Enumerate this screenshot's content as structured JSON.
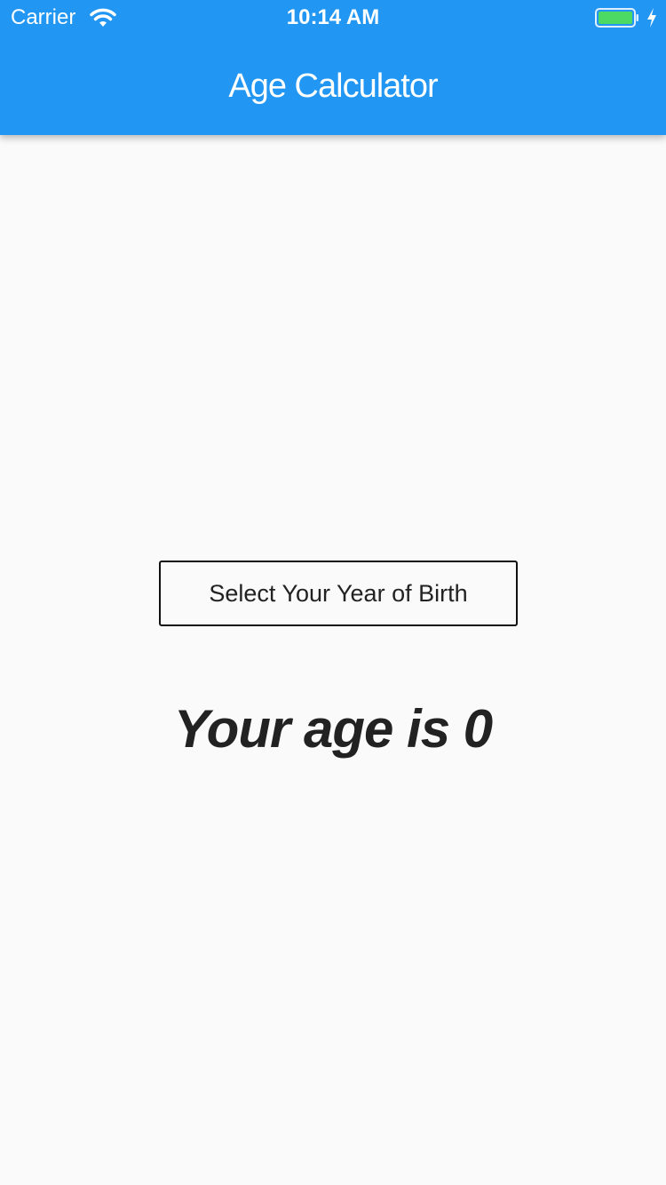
{
  "status_bar": {
    "carrier": "Carrier",
    "time": "10:14 AM",
    "wifi_icon": "wifi-icon",
    "battery_icon": "battery-icon",
    "charging_icon": "charging-bolt-icon",
    "battery_level": 1.0
  },
  "app_bar": {
    "title": "Age Calculator",
    "color": "#2196f3"
  },
  "main": {
    "select_button_label": "Select Your Year of Birth",
    "age_text": "Your age is 0"
  },
  "colors": {
    "background": "#fafafa",
    "text": "#222222",
    "battery_fill": "#4cd964"
  }
}
